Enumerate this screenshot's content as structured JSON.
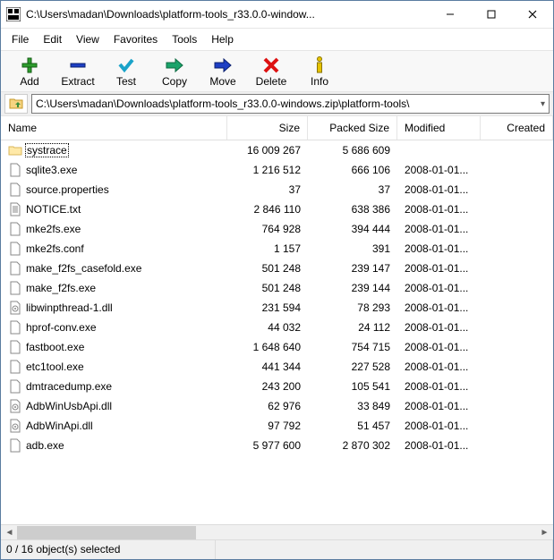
{
  "window": {
    "title": "C:\\Users\\madan\\Downloads\\platform-tools_r33.0.0-window..."
  },
  "menu": [
    "File",
    "Edit",
    "View",
    "Favorites",
    "Tools",
    "Help"
  ],
  "toolbar": [
    {
      "id": "add",
      "label": "Add"
    },
    {
      "id": "extract",
      "label": "Extract"
    },
    {
      "id": "test",
      "label": "Test"
    },
    {
      "id": "copy",
      "label": "Copy"
    },
    {
      "id": "move",
      "label": "Move"
    },
    {
      "id": "delete",
      "label": "Delete"
    },
    {
      "id": "info",
      "label": "Info"
    }
  ],
  "address": {
    "path": "C:\\Users\\madan\\Downloads\\platform-tools_r33.0.0-windows.zip\\platform-tools\\"
  },
  "columns": {
    "name": "Name",
    "size": "Size",
    "packed": "Packed Size",
    "modified": "Modified",
    "created": "Created"
  },
  "files": [
    {
      "type": "folder",
      "name": "systrace",
      "size": "16 009 267",
      "packed": "5 686 609",
      "modified": "",
      "selected": true
    },
    {
      "type": "exe",
      "name": "sqlite3.exe",
      "size": "1 216 512",
      "packed": "666 106",
      "modified": "2008-01-01..."
    },
    {
      "type": "file",
      "name": "source.properties",
      "size": "37",
      "packed": "37",
      "modified": "2008-01-01..."
    },
    {
      "type": "txt",
      "name": "NOTICE.txt",
      "size": "2 846 110",
      "packed": "638 386",
      "modified": "2008-01-01..."
    },
    {
      "type": "exe",
      "name": "mke2fs.exe",
      "size": "764 928",
      "packed": "394 444",
      "modified": "2008-01-01..."
    },
    {
      "type": "file",
      "name": "mke2fs.conf",
      "size": "1 157",
      "packed": "391",
      "modified": "2008-01-01..."
    },
    {
      "type": "exe",
      "name": "make_f2fs_casefold.exe",
      "size": "501 248",
      "packed": "239 147",
      "modified": "2008-01-01..."
    },
    {
      "type": "exe",
      "name": "make_f2fs.exe",
      "size": "501 248",
      "packed": "239 144",
      "modified": "2008-01-01..."
    },
    {
      "type": "dll",
      "name": "libwinpthread-1.dll",
      "size": "231 594",
      "packed": "78 293",
      "modified": "2008-01-01..."
    },
    {
      "type": "exe",
      "name": "hprof-conv.exe",
      "size": "44 032",
      "packed": "24 112",
      "modified": "2008-01-01..."
    },
    {
      "type": "exe",
      "name": "fastboot.exe",
      "size": "1 648 640",
      "packed": "754 715",
      "modified": "2008-01-01..."
    },
    {
      "type": "exe",
      "name": "etc1tool.exe",
      "size": "441 344",
      "packed": "227 528",
      "modified": "2008-01-01..."
    },
    {
      "type": "exe",
      "name": "dmtracedump.exe",
      "size": "243 200",
      "packed": "105 541",
      "modified": "2008-01-01..."
    },
    {
      "type": "dll",
      "name": "AdbWinUsbApi.dll",
      "size": "62 976",
      "packed": "33 849",
      "modified": "2008-01-01..."
    },
    {
      "type": "dll",
      "name": "AdbWinApi.dll",
      "size": "97 792",
      "packed": "51 457",
      "modified": "2008-01-01..."
    },
    {
      "type": "exe",
      "name": "adb.exe",
      "size": "5 977 600",
      "packed": "2 870 302",
      "modified": "2008-01-01..."
    }
  ],
  "status": {
    "selection": "0 / 16 object(s) selected"
  }
}
